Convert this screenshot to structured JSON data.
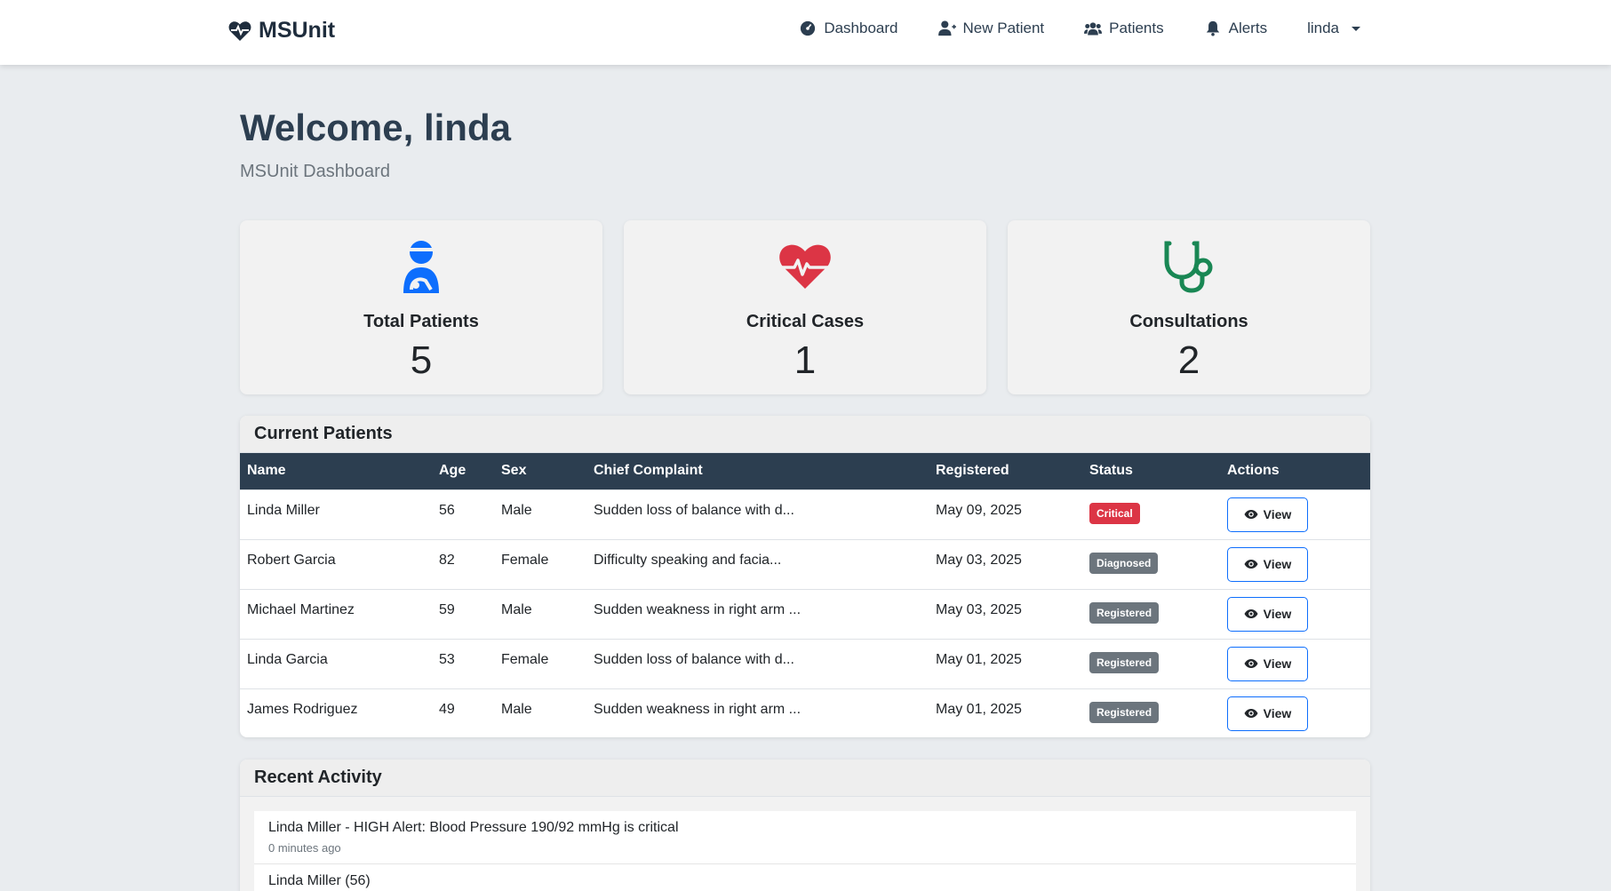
{
  "navbar": {
    "brand": "MSUnit",
    "links": [
      {
        "label": "Dashboard",
        "icon": "dashboard-icon"
      },
      {
        "label": "New Patient",
        "icon": "user-plus-icon"
      },
      {
        "label": "Patients",
        "icon": "users-icon"
      },
      {
        "label": "Alerts",
        "icon": "bell-icon"
      }
    ],
    "user": "linda"
  },
  "header": {
    "title": "Welcome, linda",
    "subtitle": "MSUnit Dashboard"
  },
  "stats": [
    {
      "label": "Total Patients",
      "value": "5",
      "icon": "patient-icon",
      "color": "#0d6efd"
    },
    {
      "label": "Critical Cases",
      "value": "1",
      "icon": "heartbeat-icon",
      "color": "#dc3545"
    },
    {
      "label": "Consultations",
      "value": "2",
      "icon": "stethoscope-icon",
      "color": "#198754"
    }
  ],
  "patients": {
    "title": "Current Patients",
    "columns": [
      "Name",
      "Age",
      "Sex",
      "Chief Complaint",
      "Registered",
      "Status",
      "Actions"
    ],
    "rows": [
      {
        "name": "Linda Miller",
        "age": "56",
        "sex": "Male",
        "complaint": "Sudden loss of balance with d...",
        "registered": "May 09, 2025",
        "status": "Critical",
        "action": "View"
      },
      {
        "name": "Robert Garcia",
        "age": "82",
        "sex": "Female",
        "complaint": "Difficulty speaking and facia...",
        "registered": "May 03, 2025",
        "status": "Diagnosed",
        "action": "View"
      },
      {
        "name": "Michael Martinez",
        "age": "59",
        "sex": "Male",
        "complaint": "Sudden weakness in right arm ...",
        "registered": "May 03, 2025",
        "status": "Registered",
        "action": "View"
      },
      {
        "name": "Linda Garcia",
        "age": "53",
        "sex": "Female",
        "complaint": "Sudden loss of balance with d...",
        "registered": "May 01, 2025",
        "status": "Registered",
        "action": "View"
      },
      {
        "name": "James Rodriguez",
        "age": "49",
        "sex": "Male",
        "complaint": "Sudden weakness in right arm ...",
        "registered": "May 01, 2025",
        "status": "Registered",
        "action": "View"
      }
    ],
    "status_colors": {
      "Critical": "#dc3545",
      "Diagnosed": "#6c757d",
      "Registered": "#6c757d"
    }
  },
  "activity": {
    "title": "Recent Activity",
    "items": [
      {
        "message": "Linda Miller - HIGH Alert: Blood Pressure 190/92 mmHg is critical",
        "time": "0 minutes ago"
      },
      {
        "message": "Linda Miller (56)",
        "time": ""
      }
    ]
  }
}
